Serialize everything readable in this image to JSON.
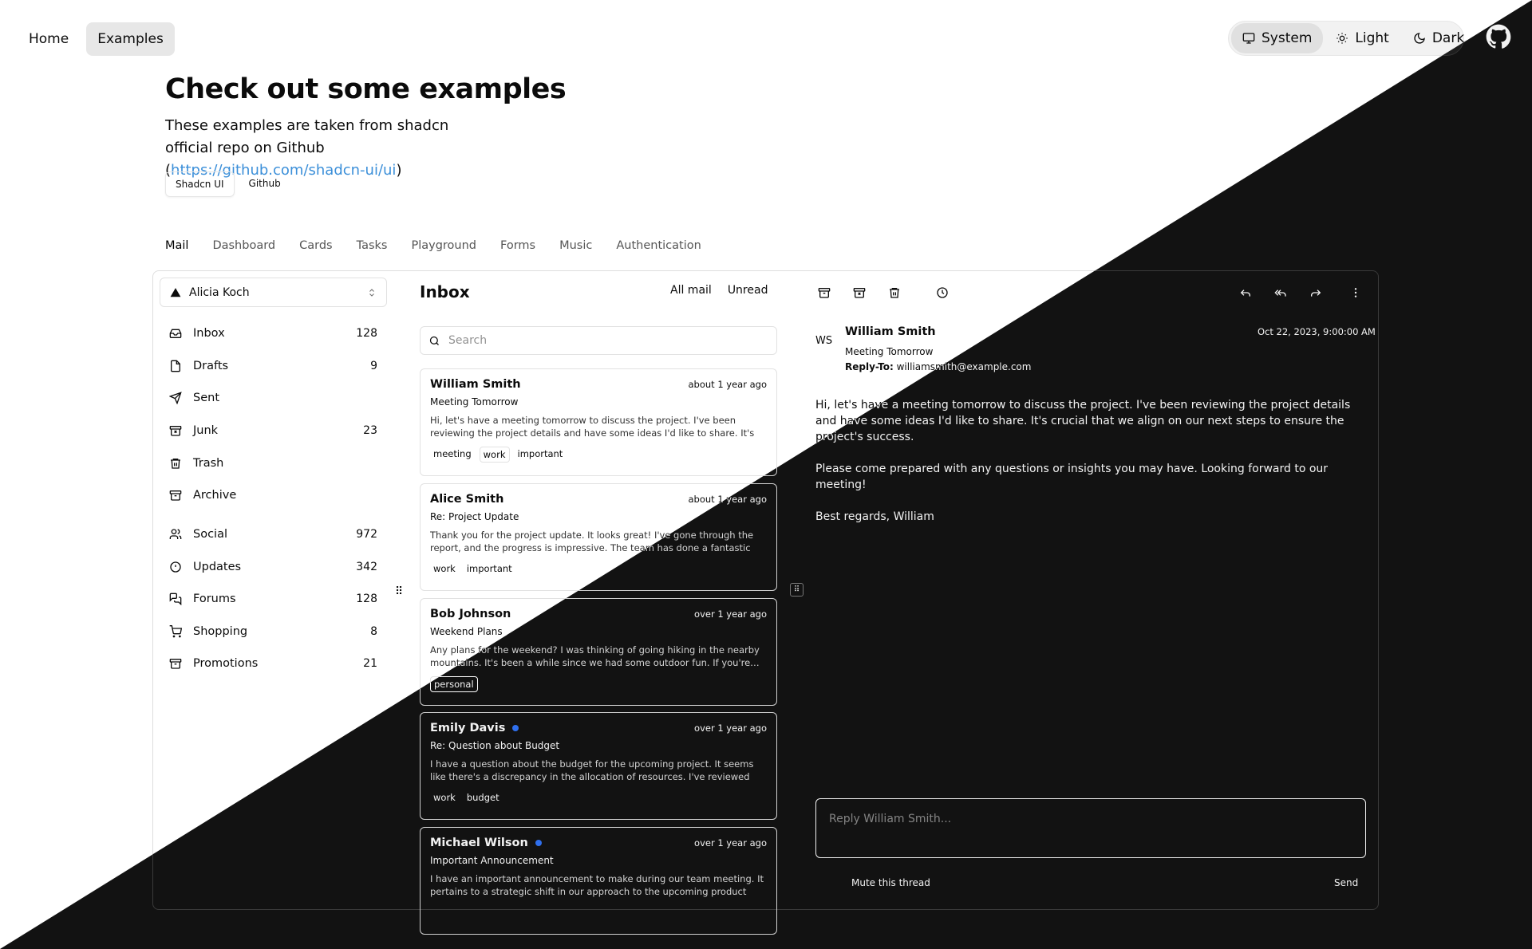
{
  "topnav": {
    "home": "Home",
    "examples": "Examples"
  },
  "theme_switch": {
    "system": "System",
    "light": "Light",
    "dark": "Dark",
    "selected": "System"
  },
  "hero": {
    "title": "Check out some examples",
    "subtitle_prefix": "These examples are taken from shadcn official repo on Github (",
    "link": "https://github.com/shadcn-ui/ui",
    "subtitle_suffix": ")",
    "badges": [
      "Shadcn UI",
      "Github"
    ]
  },
  "tabs": [
    "Mail",
    "Dashboard",
    "Cards",
    "Tasks",
    "Playground",
    "Forms",
    "Music",
    "Authentication"
  ],
  "account": {
    "name": "Alicia Koch"
  },
  "nav_primary": [
    {
      "label": "Inbox",
      "count": "128",
      "icon": "inbox-icon"
    },
    {
      "label": "Drafts",
      "count": "9",
      "icon": "file-icon"
    },
    {
      "label": "Sent",
      "count": "",
      "icon": "send-icon"
    },
    {
      "label": "Junk",
      "count": "23",
      "icon": "archive-x-icon"
    },
    {
      "label": "Trash",
      "count": "",
      "icon": "trash-icon"
    },
    {
      "label": "Archive",
      "count": "",
      "icon": "archive-icon"
    }
  ],
  "nav_secondary": [
    {
      "label": "Social",
      "count": "972",
      "icon": "users-icon"
    },
    {
      "label": "Updates",
      "count": "342",
      "icon": "alert-circle-icon"
    },
    {
      "label": "Forums",
      "count": "128",
      "icon": "messages-icon"
    },
    {
      "label": "Shopping",
      "count": "8",
      "icon": "cart-icon"
    },
    {
      "label": "Promotions",
      "count": "21",
      "icon": "archive-icon"
    }
  ],
  "inbox": {
    "title": "Inbox",
    "filters": [
      "All mail",
      "Unread"
    ],
    "search_placeholder": "Search",
    "mails": [
      {
        "name": "William Smith",
        "unread": false,
        "time": "about 1 year ago",
        "subject": "Meeting Tomorrow",
        "preview": "Hi, let's have a meeting tomorrow to discuss the project. I've been reviewing the project details and have some ideas I'd like to share. It's crucial that we…",
        "tags": [
          "meeting",
          "work",
          "important"
        ]
      },
      {
        "name": "Alice Smith",
        "unread": false,
        "time": "about 1 year ago",
        "subject": "Re: Project Update",
        "preview": "Thank you for the project update. It looks great! I've gone through the report, and the progress is impressive. The team has done a fantastic job, and I…",
        "tags": [
          "work",
          "important"
        ]
      },
      {
        "name": "Bob Johnson",
        "unread": false,
        "time": "over 1 year ago",
        "subject": "Weekend Plans",
        "preview": "Any plans for the weekend? I was thinking of going hiking in the nearby mountains. It's been a while since we had some outdoor fun. If you're…",
        "tags": [
          "personal"
        ]
      },
      {
        "name": "Emily Davis",
        "unread": true,
        "time": "over 1 year ago",
        "subject": "Re: Question about Budget",
        "preview": "I have a question about the budget for the upcoming project. It seems like there's a discrepancy in the allocation of resources. I've reviewed the budget…",
        "tags": [
          "work",
          "budget"
        ]
      },
      {
        "name": "Michael Wilson",
        "unread": true,
        "time": "over 1 year ago",
        "subject": "Important Announcement",
        "preview": "I have an important announcement to make during our team meeting. It pertains to a strategic shift in our approach to the upcoming product launch.…",
        "tags": []
      }
    ]
  },
  "detail": {
    "avatar": "WS",
    "from": "William Smith",
    "subject": "Meeting Tomorrow",
    "reply_to_label": "Reply-To:",
    "reply_to": "williamsmith@example.com",
    "date": "Oct 22, 2023, 9:00:00 AM",
    "body": [
      "Hi, let's have a meeting tomorrow to discuss the project. I've been reviewing the project details and have some ideas I'd like to share. It's crucial that we align on our next steps to ensure the project's success.",
      "Please come prepared with any questions or insights you may have. Looking forward to our meeting!",
      "Best regards, William"
    ],
    "reply_placeholder": "Reply William Smith...",
    "mute": "Mute this thread",
    "send": "Send"
  }
}
